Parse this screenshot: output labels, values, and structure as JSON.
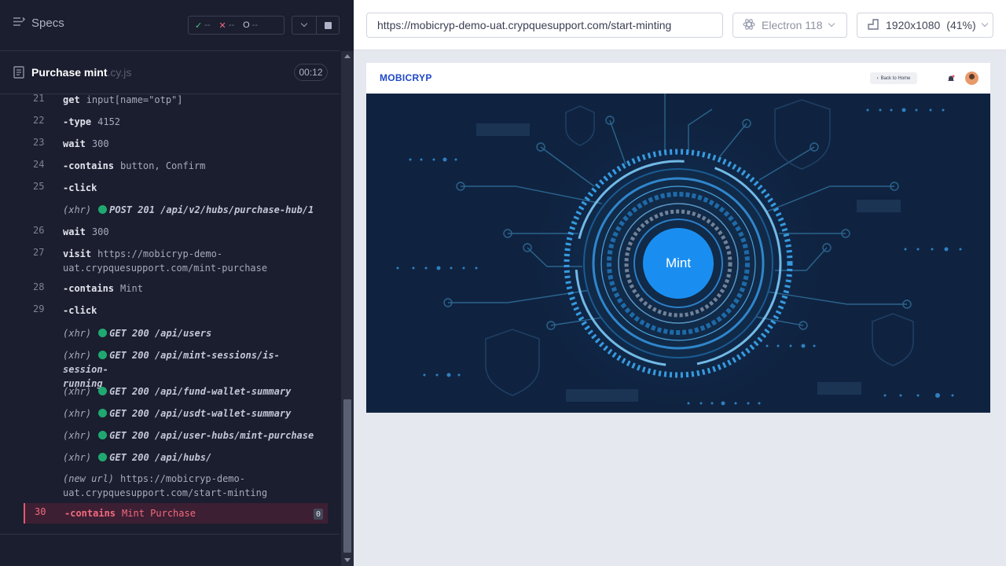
{
  "runner": {
    "specs_label": "Specs",
    "stats": {
      "passed": "--",
      "failed": "--",
      "pending": "--"
    },
    "spec": {
      "name": "Purchase mint",
      "ext": ".cy.js",
      "duration": "00:12"
    }
  },
  "commands": [
    {
      "num": "21",
      "name": "get",
      "arg": "input[name=\"otp\"]"
    },
    {
      "num": "22",
      "name": "-type",
      "arg": "4152"
    },
    {
      "num": "23",
      "name": "wait",
      "arg": "300"
    },
    {
      "num": "24",
      "name": "-contains",
      "arg": "button, Confirm"
    },
    {
      "num": "25",
      "name": "-click",
      "arg": ""
    },
    {
      "num": "",
      "xhr": "(xhr)",
      "text": "POST 201 /api/v2/hubs/purchase-hub/1"
    },
    {
      "num": "26",
      "name": "wait",
      "arg": "300"
    },
    {
      "num": "27",
      "name": "visit",
      "arg": "https://mobicryp-demo-",
      "arg2": "uat.crypquesupport.com/mint-purchase"
    },
    {
      "num": "28",
      "name": "-contains",
      "arg": "Mint"
    },
    {
      "num": "29",
      "name": "-click",
      "arg": ""
    },
    {
      "num": "",
      "xhr": "(xhr)",
      "text": "GET 200 /api/users"
    },
    {
      "num": "",
      "xhr": "(xhr)",
      "text": "GET 200 /api/mint-sessions/is-session-",
      "text2": "running"
    },
    {
      "num": "",
      "xhr": "(xhr)",
      "text": "GET 200 /api/fund-wallet-summary"
    },
    {
      "num": "",
      "xhr": "(xhr)",
      "text": "GET 200 /api/usdt-wallet-summary"
    },
    {
      "num": "",
      "xhr": "(xhr)",
      "text": "GET 200 /api/user-hubs/mint-purchase"
    },
    {
      "num": "",
      "xhr": "(xhr)",
      "text": "GET 200 /api/hubs/"
    },
    {
      "num": "",
      "newurl": "(new url)",
      "arg": "https://mobicryp-demo-",
      "arg2": "uat.crypquesupport.com/start-minting"
    },
    {
      "num": "30",
      "name": "-contains",
      "arg": "Mint Purchase",
      "error": true,
      "badge": "0"
    }
  ],
  "aut": {
    "url": "https://mobicryp-demo-uat.crypquesupport.com/start-minting",
    "browser": "Electron 118",
    "viewport": "1920x1080",
    "scale": "(41%)",
    "app": {
      "logo": "MOBICRYP",
      "back_label": "Back to Home",
      "mint_label": "Mint"
    }
  },
  "colors": {
    "runner_bg": "#1b1e2e",
    "error_row": "#3d1f33",
    "pass": "#4fc08d",
    "fail": "#f26a7d",
    "mint_blue": "#1a8ef0",
    "hero_bg": "#0f2340"
  }
}
